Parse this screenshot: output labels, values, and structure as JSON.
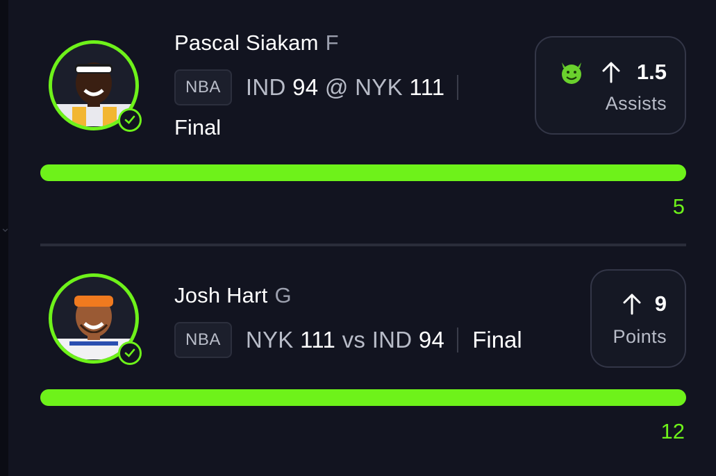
{
  "colors": {
    "accent": "#6ef21a",
    "background": "#121420",
    "muted_text": "#b8bcc8"
  },
  "picks": [
    {
      "player_name": "Pascal Siakam",
      "position": "F",
      "league": "NBA",
      "game": {
        "team_a": "IND",
        "score_a": "94",
        "connector": "@",
        "team_b": "NYK",
        "score_b": "111"
      },
      "status": "Final",
      "direction_icon": "arrow-up-icon",
      "emoji_icon": "devil-smile-icon",
      "line": "1.5",
      "stat": "Assists",
      "progress": 1.0,
      "actual": "5",
      "checked": true
    },
    {
      "player_name": "Josh Hart",
      "position": "G",
      "league": "NBA",
      "game": {
        "team_a": "NYK",
        "score_a": "111",
        "connector": "vs",
        "team_b": "IND",
        "score_b": "94"
      },
      "status": "Final",
      "direction_icon": "arrow-up-icon",
      "line": "9",
      "stat": "Points",
      "progress": 1.0,
      "actual": "12",
      "checked": true
    }
  ]
}
